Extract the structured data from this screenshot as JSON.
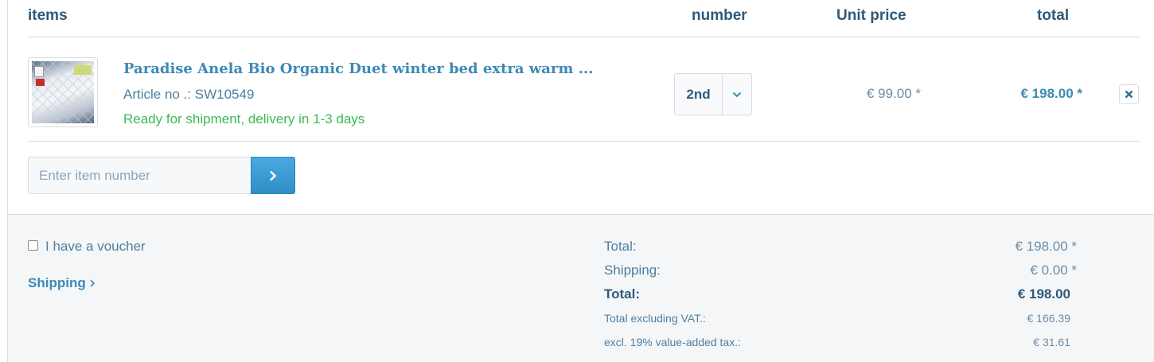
{
  "header": {
    "items_label": "items",
    "number_label": "number",
    "unit_price_label": "Unit price",
    "total_label": "total"
  },
  "item": {
    "title": "Paradise Anela Bio Organic Duet winter bed extra warm ...",
    "article_no": "Article no .: SW10549",
    "delivery": "Ready for shipment, delivery in 1-3 days",
    "quantity": "2nd",
    "unit_price": "€ 99.00 *",
    "total": "€ 198.00 *"
  },
  "add_item": {
    "placeholder": "Enter item number"
  },
  "footer": {
    "voucher_label": "I have a voucher",
    "shipping_link": "Shipping",
    "summary": {
      "total_label": "Total:",
      "total_value": "€ 198.00 *",
      "shipping_label": "Shipping:",
      "shipping_value": "€ 0.00 *",
      "grand_total_label": "Total:",
      "grand_total_value": "€ 198.00",
      "excl_vat_label": "Total excluding VAT.:",
      "excl_vat_value": "€ 166.39",
      "vat_label": "excl. 19% value-added tax.:",
      "vat_value": "€ 31.61"
    }
  },
  "colors": {
    "accent": "#3c8ab7",
    "heading": "#2f5a7a",
    "success": "#3cba54",
    "button": "#3a9bd5"
  },
  "icons": {
    "qty_dropdown": "chevron-down-icon",
    "remove": "close-icon",
    "add_submit": "chevron-right-icon",
    "shipping_link": "chevron-right-icon"
  }
}
